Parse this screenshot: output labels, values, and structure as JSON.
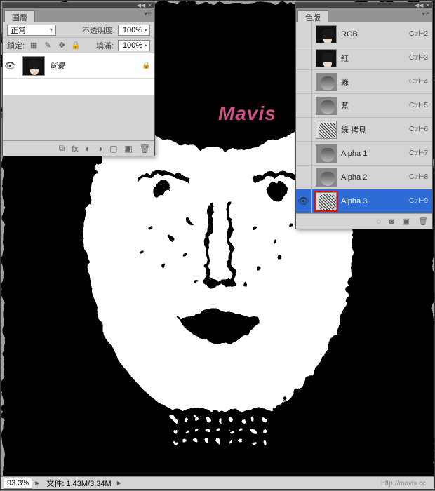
{
  "watermark": "Mavis",
  "url_credit": "http://mavis.cc",
  "statusbar": {
    "zoom": "93.3%",
    "file": "文件: 1.43M/3.34M"
  },
  "layers_panel": {
    "tab": "圖層",
    "blend_mode": "正常",
    "opacity_label": "不透明度:",
    "opacity_value": "100%",
    "lock_label": "鎖定:",
    "fill_label": "填滿:",
    "fill_value": "100%",
    "layer": {
      "name": "背景"
    }
  },
  "channels_panel": {
    "tab": "色版",
    "items": [
      {
        "name": "RGB",
        "shortcut": "Ctrl+2",
        "thumb": "face"
      },
      {
        "name": "紅",
        "shortcut": "Ctrl+3",
        "thumb": "face"
      },
      {
        "name": "綠",
        "shortcut": "Ctrl+4",
        "thumb": "gray"
      },
      {
        "name": "藍",
        "shortcut": "Ctrl+5",
        "thumb": "gray"
      },
      {
        "name": "綠 拷貝",
        "shortcut": "Ctrl+6",
        "thumb": "line"
      },
      {
        "name": "Alpha 1",
        "shortcut": "Ctrl+7",
        "thumb": "gray"
      },
      {
        "name": "Alpha 2",
        "shortcut": "Ctrl+8",
        "thumb": "gray"
      },
      {
        "name": "Alpha 3",
        "shortcut": "Ctrl+9",
        "thumb": "line",
        "selected": true,
        "highlight": true,
        "visible": true
      }
    ]
  }
}
